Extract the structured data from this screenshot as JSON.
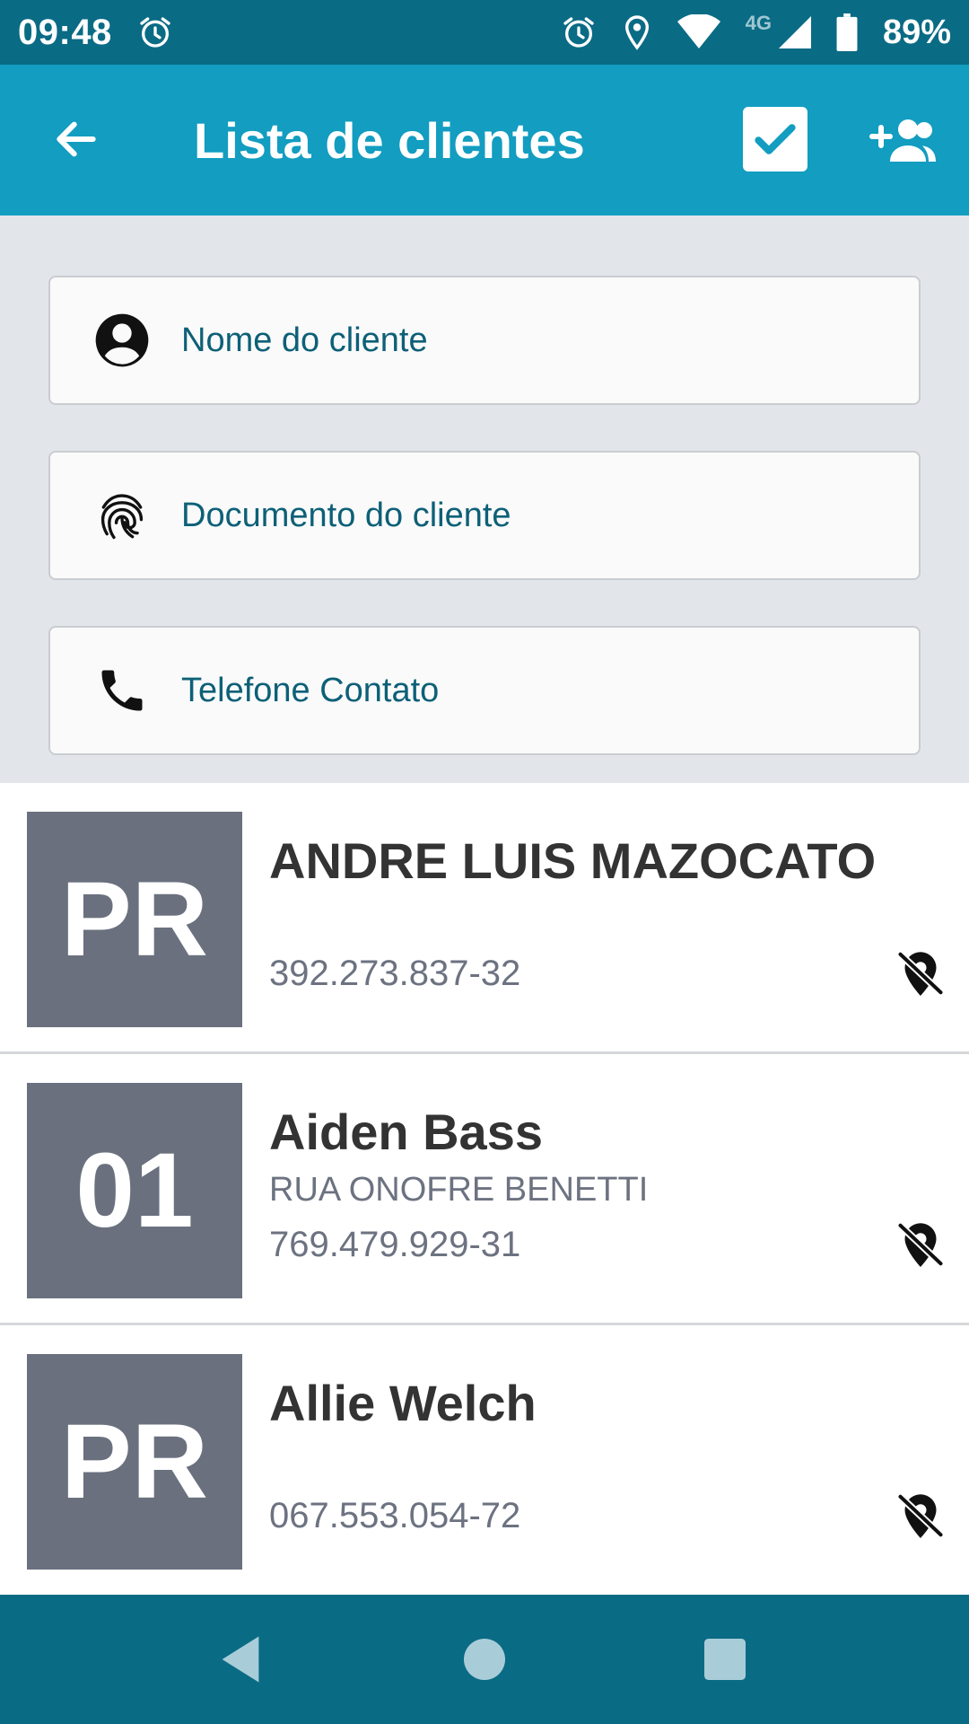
{
  "status_bar": {
    "time": "09:48",
    "battery": "89%",
    "network": "4G",
    "icons": [
      "alarm-icon",
      "alarm-icon",
      "location-icon",
      "wifi-icon",
      "signal-icon",
      "battery-icon"
    ]
  },
  "app_bar": {
    "title": "Lista de clientes",
    "icons": [
      "arrow-back-icon",
      "checkbox-checked-icon",
      "add-user-icon"
    ],
    "color": "#129dc1"
  },
  "filters": {
    "name_placeholder": "Nome do cliente",
    "document_placeholder": "Documento do cliente",
    "phone_placeholder": "Telefone Contato"
  },
  "clients": [
    {
      "badge": "PR",
      "name": "ANDRE LUIS MAZOCATO",
      "address": "",
      "document": "392.273.837-32"
    },
    {
      "badge": "01",
      "name": "Aiden Bass",
      "address": "RUA ONOFRE BENETTI",
      "document": "769.479.929-31"
    },
    {
      "badge": "PR",
      "name": "Allie Welch",
      "address": "",
      "document": "067.553.054-72"
    }
  ],
  "nav_bar": {
    "icons": [
      "nav-back-icon",
      "nav-home-icon",
      "nav-recents-icon"
    ],
    "color": "#0a6b85"
  }
}
